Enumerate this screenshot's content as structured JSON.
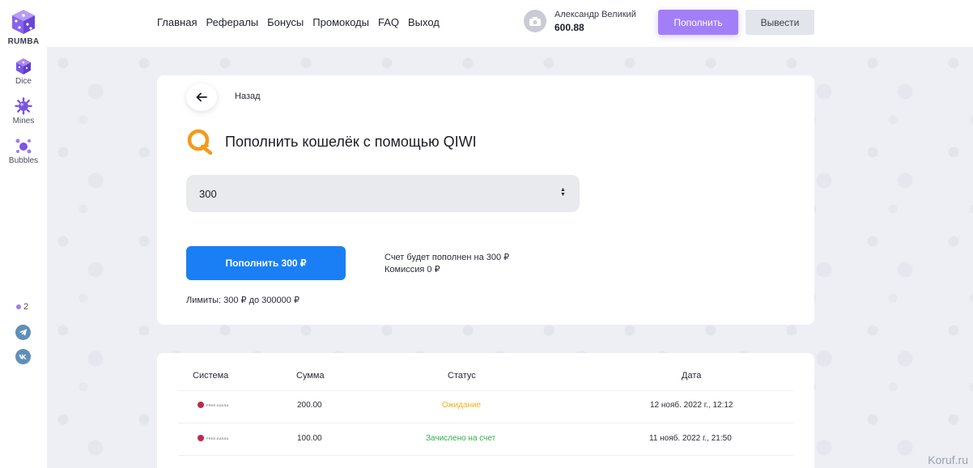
{
  "sidebar": {
    "logo_label": "RUMBA",
    "items": [
      {
        "label": "Dice",
        "icon": "dice-icon"
      },
      {
        "label": "Mines",
        "icon": "mine-icon"
      },
      {
        "label": "Bubbles",
        "icon": "bubbles-icon"
      }
    ],
    "online_count": "2",
    "socials": [
      {
        "icon": "telegram-icon"
      },
      {
        "icon": "vk-icon"
      }
    ]
  },
  "header": {
    "nav": [
      "Главная",
      "Рефералы",
      "Бонусы",
      "Промокоды",
      "FAQ",
      "Выход"
    ],
    "user_name": "Александр Великий",
    "user_balance": "600.88",
    "deposit_label": "Пополнить",
    "withdraw_label": "Вывести"
  },
  "deposit": {
    "back_label": "Назад",
    "title": "Пополнить кошелёк с помощью QIWI",
    "amount": "300",
    "pay_label": "Пополнить 300 ₽",
    "info_line1": "Счет будет пополнен на 300 ₽",
    "info_line2": "Комиссия 0 ₽",
    "limits": "Лимиты: 300 ₽ до 300000 ₽"
  },
  "history": {
    "columns": [
      "Система",
      "Сумма",
      "Статус",
      "Дата"
    ],
    "rows": [
      {
        "system": "FREE-KASSA",
        "amount": "200.00",
        "status": "Ожидание",
        "date": "12 нояб. 2022 г., 12:12"
      },
      {
        "system": "FREE-KASSA",
        "amount": "100.00",
        "status": "Зачислено на счет",
        "date": "11 нояб. 2022 г., 21:50"
      }
    ]
  },
  "watermark": "Koruf.ru",
  "colors": {
    "accent": "#a27ff7",
    "primary_button": "#1a7ff5",
    "pending": "#f3b21b",
    "done": "#2fae4a",
    "qiwi": "#f39a1a"
  }
}
